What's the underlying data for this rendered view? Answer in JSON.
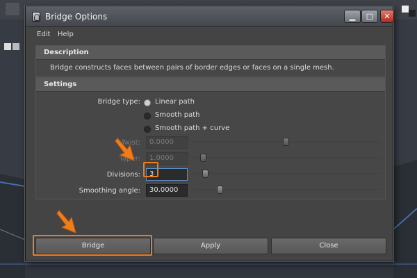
{
  "window": {
    "title": "Bridge Options"
  },
  "menubar": {
    "items": [
      "Edit",
      "Help"
    ]
  },
  "description": {
    "header": "Description",
    "text": "Bridge constructs faces between pairs of border edges or faces on a single mesh."
  },
  "settings": {
    "header": "Settings",
    "bridge_type": {
      "label": "Bridge type:",
      "options": [
        "Linear path",
        "Smooth path",
        "Smooth path + curve"
      ],
      "selected": "Linear path"
    },
    "twist": {
      "label": "Twist:",
      "value": "0.0000",
      "enabled": false,
      "slider_fraction": 0.5
    },
    "taper": {
      "label": "Taper:",
      "value": "1.0000",
      "enabled": false,
      "slider_fraction": 0.08
    },
    "divisions": {
      "label": "Divisions:",
      "value": "3",
      "enabled": true,
      "slider_fraction": 0.1
    },
    "smoothing_angle": {
      "label": "Smoothing angle:",
      "value": "30.0000",
      "enabled": true,
      "slider_fraction": 0.18
    }
  },
  "buttons": {
    "bridge": "Bridge",
    "apply": "Apply",
    "close": "Close"
  },
  "colors": {
    "highlight": "#f07d1c",
    "dialog_bg": "#444444",
    "focus": "#5b8fc5"
  }
}
